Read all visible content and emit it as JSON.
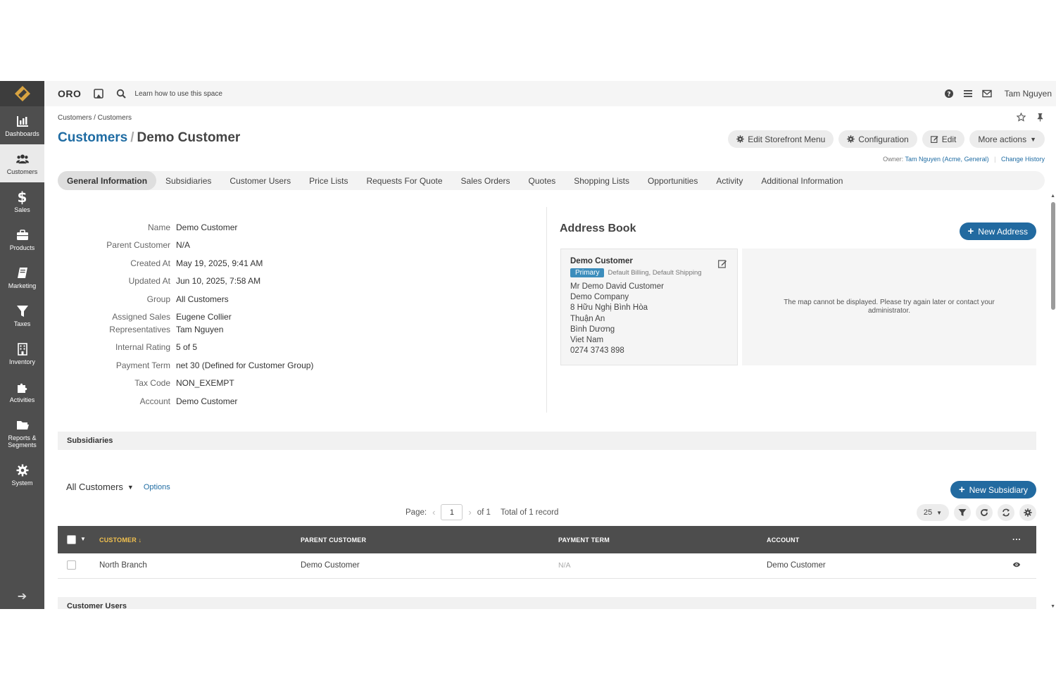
{
  "sidebar": {
    "items": [
      {
        "label": "Dashboards",
        "icon": "chart-icon"
      },
      {
        "label": "Customers",
        "icon": "users-icon"
      },
      {
        "label": "Sales",
        "icon": "dollar-icon"
      },
      {
        "label": "Products",
        "icon": "briefcase-icon"
      },
      {
        "label": "Marketing",
        "icon": "book-icon"
      },
      {
        "label": "Taxes",
        "icon": "filter-icon"
      },
      {
        "label": "Inventory",
        "icon": "building-icon"
      },
      {
        "label": "Activities",
        "icon": "puzzle-icon"
      },
      {
        "label": "Reports & Segments",
        "icon": "folder-icon"
      },
      {
        "label": "System",
        "icon": "cog-icon"
      }
    ],
    "active": "Customers"
  },
  "topbar": {
    "brand": "ORO",
    "learn": "Learn how to use this space",
    "user": "Tam Nguyen"
  },
  "breadcrumb": "Customers / Customers",
  "title": {
    "section": "Customers",
    "separator": "/",
    "name": "Demo Customer"
  },
  "actions": {
    "edit_storefront": "Edit Storefront Menu",
    "configuration": "Configuration",
    "edit": "Edit",
    "more": "More actions"
  },
  "owner": {
    "label": "Owner:",
    "name": "Tam Nguyen",
    "org_open": "(",
    "org1": "Acme",
    "org_sep": ", ",
    "org2": "General",
    "org_close": ")",
    "change_history": "Change History"
  },
  "tabs": [
    "General Information",
    "Subsidiaries",
    "Customer Users",
    "Price Lists",
    "Requests For Quote",
    "Sales Orders",
    "Quotes",
    "Shopping Lists",
    "Opportunities",
    "Activity",
    "Additional Information"
  ],
  "info": {
    "name_label": "Name",
    "name": "Demo Customer",
    "parent_label": "Parent Customer",
    "parent": "N/A",
    "created_label": "Created At",
    "created": "May 19, 2025, 9:41 AM",
    "updated_label": "Updated At",
    "updated": "Jun 10, 2025, 7:58 AM",
    "group_label": "Group",
    "group": "All Customers",
    "assigned_label_1": "Assigned Sales",
    "assigned_label_2": "Representatives",
    "assigned_1": "Eugene Collier",
    "assigned_2": "Tam Nguyen",
    "rating_label": "Internal Rating",
    "rating": "5 of 5",
    "payment_label": "Payment Term",
    "payment": "net 30 (Defined for Customer Group)",
    "tax_label": "Tax Code",
    "tax": "NON_EXEMPT",
    "account_label": "Account",
    "account": "Demo Customer"
  },
  "address_book": {
    "title": "Address Book",
    "new_address": "New Address",
    "card": {
      "name": "Demo Customer",
      "badge": "Primary",
      "types": "Default Billing, Default Shipping",
      "lines": [
        "Mr Demo David Customer",
        "Demo Company",
        "8 Hữu Nghị Bình Hòa",
        "Thuận An",
        "Bình Dương",
        "Viet Nam",
        "0274 3743 898"
      ]
    },
    "map_message": "The map cannot be displayed. Please try again later or contact your administrator."
  },
  "subsidiaries": {
    "section_title": "Subsidiaries",
    "view": "All Customers",
    "options": "Options",
    "new_subsidiary": "New Subsidiary",
    "pager": {
      "page_label": "Page:",
      "page": "1",
      "of": "of 1",
      "total": "Total of 1 record"
    },
    "per_page": "25",
    "columns": [
      "CUSTOMER",
      "PARENT CUSTOMER",
      "PAYMENT TERM",
      "ACCOUNT"
    ],
    "rows": [
      {
        "customer": "North Branch",
        "parent": "Demo Customer",
        "payment_term": "N/A",
        "account": "Demo Customer"
      }
    ]
  },
  "customer_users_section": "Customer Users",
  "colors": {
    "sidebar": "#4e4e4e",
    "accent": "#226aa0",
    "link": "#1f6ca3",
    "sorted_header": "#f2c14e"
  }
}
